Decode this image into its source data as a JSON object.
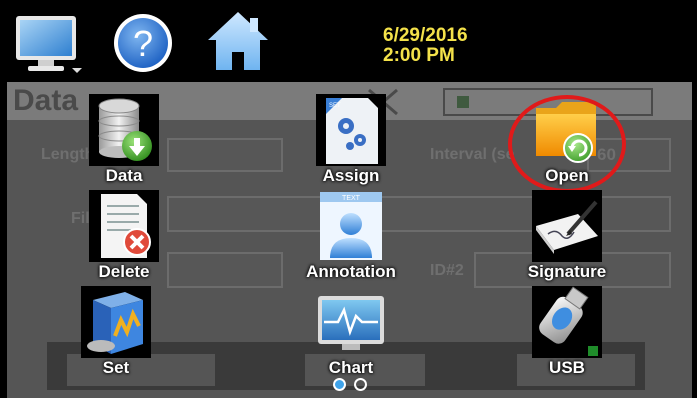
{
  "header": {
    "date": "6/29/2016",
    "time": "2:00 PM"
  },
  "background": {
    "title": "Data",
    "labels": {
      "length": "Length",
      "interval": "Interval (se",
      "interval_value": "60",
      "file": "Fil",
      "id2": "ID#2"
    }
  },
  "menu": {
    "tiles": [
      {
        "label": "Data"
      },
      {
        "label": "Assign"
      },
      {
        "label": "Open"
      },
      {
        "label": "Delete"
      },
      {
        "label": "Annotation"
      },
      {
        "label": "Signature"
      },
      {
        "label": "Set"
      },
      {
        "label": "Chart"
      },
      {
        "label": "USB"
      }
    ]
  },
  "pager": {
    "current_page": 1,
    "page_count": 2
  },
  "colors": {
    "datetime": "#f4e24a",
    "highlight": "#e01a1a",
    "pager_active": "#3fa3ea"
  }
}
